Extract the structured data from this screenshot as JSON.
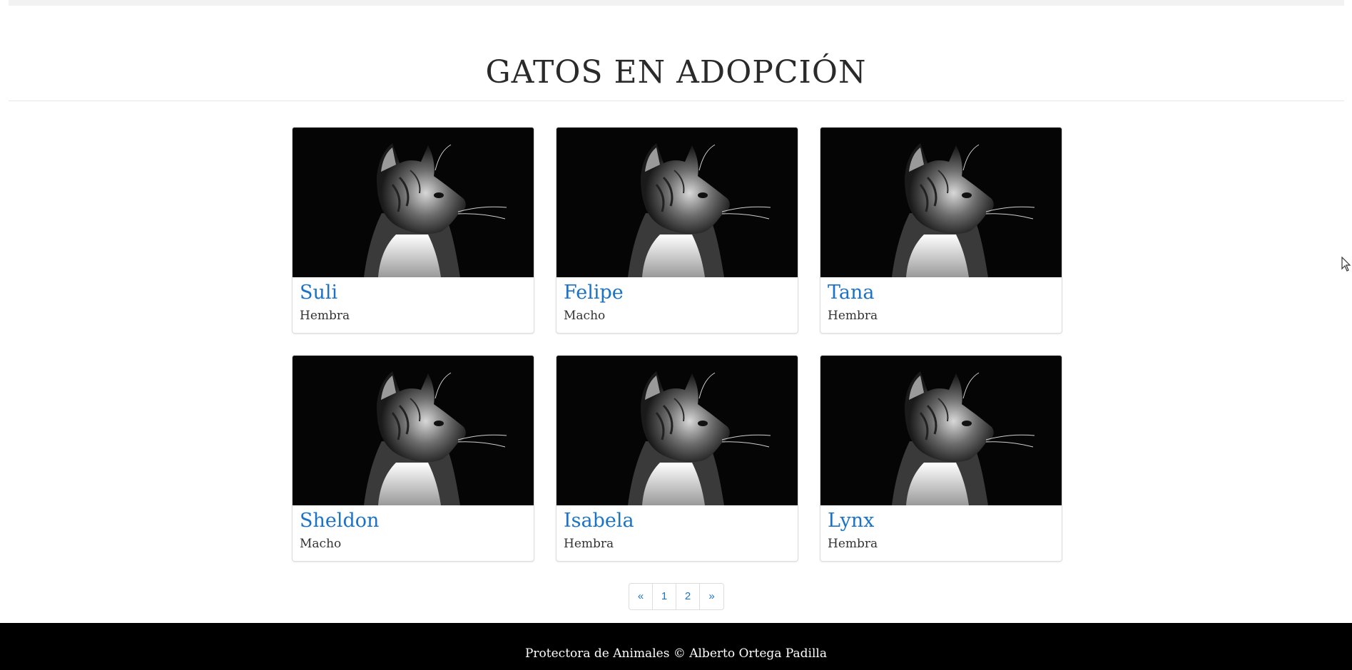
{
  "header": {
    "title": "GATOS EN ADOPCIÓN"
  },
  "cats": [
    {
      "name": "Suli",
      "sex": "Hembra",
      "image": "cat-profile-photo"
    },
    {
      "name": "Felipe",
      "sex": "Macho",
      "image": "cat-profile-photo"
    },
    {
      "name": "Tana",
      "sex": "Hembra",
      "image": "cat-profile-photo"
    },
    {
      "name": "Sheldon",
      "sex": "Macho",
      "image": "cat-profile-photo"
    },
    {
      "name": "Isabela",
      "sex": "Hembra",
      "image": "cat-profile-photo"
    },
    {
      "name": "Lynx",
      "sex": "Hembra",
      "image": "cat-profile-photo"
    }
  ],
  "pagination": {
    "prev": "«",
    "pages": [
      "1",
      "2"
    ],
    "next": "»"
  },
  "footer": {
    "text": "Protectora de Animales © Alberto Ortega Padilla"
  },
  "colors": {
    "link": "#1a73c8",
    "footer_bg": "#000000"
  }
}
